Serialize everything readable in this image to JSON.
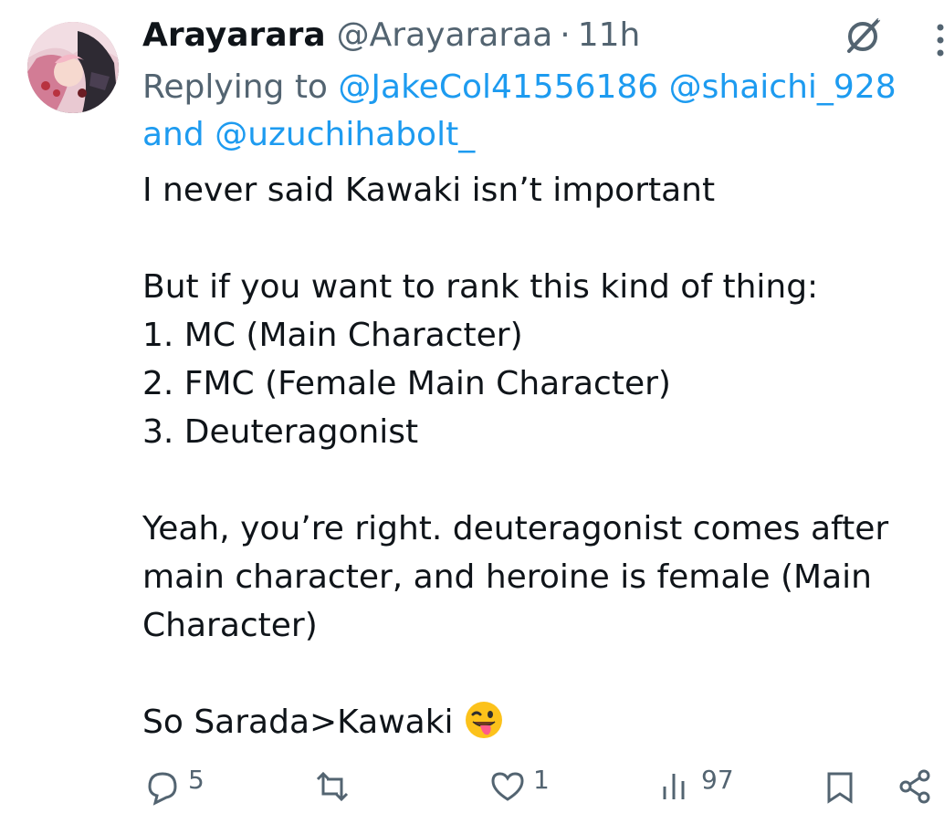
{
  "tweet": {
    "display_name": "Arayarara",
    "handle": "@Arayararaa",
    "separator": "·",
    "time": "11h",
    "replying_prefix": "Replying to",
    "mentions": [
      "@JakeCol41556186",
      "@shaichi_928",
      "@uzuchihabolt_"
    ],
    "and_word": "and",
    "lines": [
      "I never said Kawaki isn’t important",
      "",
      "But if you want to rank this kind of thing:",
      "1. MC (Main Character)",
      "2. FMC (Female Main Character)",
      "3. Deuteragonist",
      "",
      "Yeah, you’re right. deuteragonist comes after main character, and heroine is female (Main Character)",
      "",
      "So Sarada>Kawaki"
    ],
    "final_emoji": "winking-face-with-tongue"
  },
  "actions": {
    "reply_count": "5",
    "like_count": "1",
    "views_count": "97"
  },
  "icons": {
    "grok": "grok-icon",
    "more": "more-icon",
    "reply": "reply-icon",
    "repost": "repost-icon",
    "like": "like-icon",
    "views": "views-icon",
    "bookmark": "bookmark-icon",
    "share": "share-icon"
  },
  "colors": {
    "text": "#0f1419",
    "secondary": "#536471",
    "link": "#1d9bf0"
  }
}
